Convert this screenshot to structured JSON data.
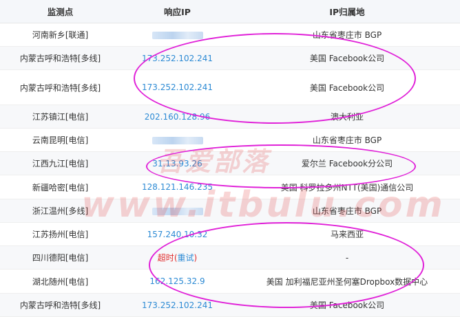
{
  "header": {
    "col_location": "监测点",
    "col_ip": "响应IP",
    "col_geo": "IP归属地"
  },
  "rows": [
    {
      "location": "河南新乡[联通]",
      "ip": "",
      "ip_blurred": true,
      "geo": "山东省枣庄市 BGP"
    },
    {
      "location": "内蒙古呼和浩特[多线]",
      "ip": "173.252.102.241",
      "geo": "美国 Facebook公司"
    },
    {
      "location": "内蒙古呼和浩特[多线]",
      "ip": "173.252.102.241",
      "geo": "美国 Facebook公司"
    },
    {
      "location": "江苏镇江[电信]",
      "ip": "202.160.128.96",
      "geo": "澳大利亚"
    },
    {
      "location": "云南昆明[电信]",
      "ip": "",
      "ip_blurred": true,
      "geo": "山东省枣庄市 BGP"
    },
    {
      "location": "江西九江[电信]",
      "ip": "31.13.93.26",
      "geo": "爱尔兰 Facebook分公司"
    },
    {
      "location": "新疆哈密[电信]",
      "ip": "128.121.146.235",
      "geo": "美国 科罗拉多州NTT(美国)通信公司"
    },
    {
      "location": "浙江温州[多线]",
      "ip": "",
      "ip_blurred": true,
      "geo": "山东省枣庄市 BGP"
    },
    {
      "location": "江苏扬州[电信]",
      "ip": "157.240.10.32",
      "geo": "马来西亚"
    },
    {
      "location": "四川德阳[电信]",
      "ip": "",
      "timeout": true,
      "geo": "-"
    },
    {
      "location": "湖北随州[电信]",
      "ip": "162.125.32.9",
      "geo": "美国 加利福尼亚州圣何塞Dropbox数据中心"
    },
    {
      "location": "内蒙古呼和浩特[多线]",
      "ip": "173.252.102.241",
      "geo": "美国 Facebook公司"
    }
  ],
  "timeout_text": "超时",
  "retry_text": "重试",
  "paren_open": "(",
  "paren_close": ")",
  "watermark": {
    "text_cn": "吾爱部落",
    "text_url": "www.itbulu.com"
  },
  "colors": {
    "ip_link": "#2c8ad4",
    "timeout": "#e02b2b",
    "annotation_ellipse": "#e020d8"
  }
}
